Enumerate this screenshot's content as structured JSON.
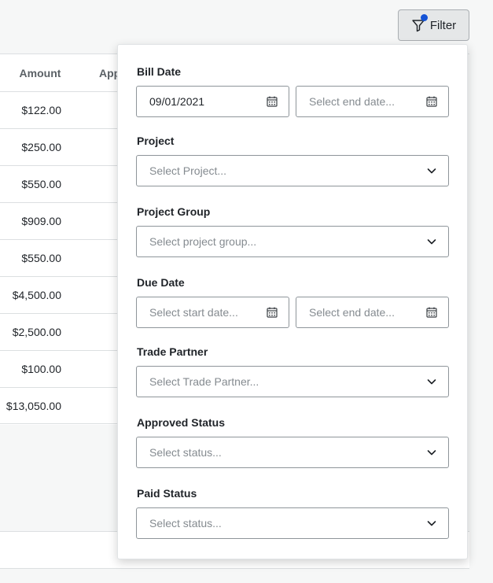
{
  "filter_button": {
    "label": "Filter"
  },
  "table": {
    "headers": {
      "amount": "Amount",
      "approved": "App"
    },
    "amounts": [
      "$122.00",
      "$250.00",
      "$550.00",
      "$909.00",
      "$550.00",
      "$4,500.00",
      "$2,500.00",
      "$100.00",
      "$13,050.00"
    ]
  },
  "filters": {
    "bill_date": {
      "label": "Bill Date",
      "start_value": "09/01/2021",
      "end_placeholder": "Select end date..."
    },
    "project": {
      "label": "Project",
      "placeholder": "Select Project..."
    },
    "project_group": {
      "label": "Project Group",
      "placeholder": "Select project group..."
    },
    "due_date": {
      "label": "Due Date",
      "start_placeholder": "Select start date...",
      "end_placeholder": "Select end date..."
    },
    "trade_partner": {
      "label": "Trade Partner",
      "placeholder": "Select Trade Partner..."
    },
    "approved_status": {
      "label": "Approved Status",
      "placeholder": "Select status..."
    },
    "paid_status": {
      "label": "Paid Status",
      "placeholder": "Select status..."
    }
  },
  "colors": {
    "accent_dot": "#1553d6",
    "border": "#8e959a",
    "placeholder": "#858b90"
  }
}
